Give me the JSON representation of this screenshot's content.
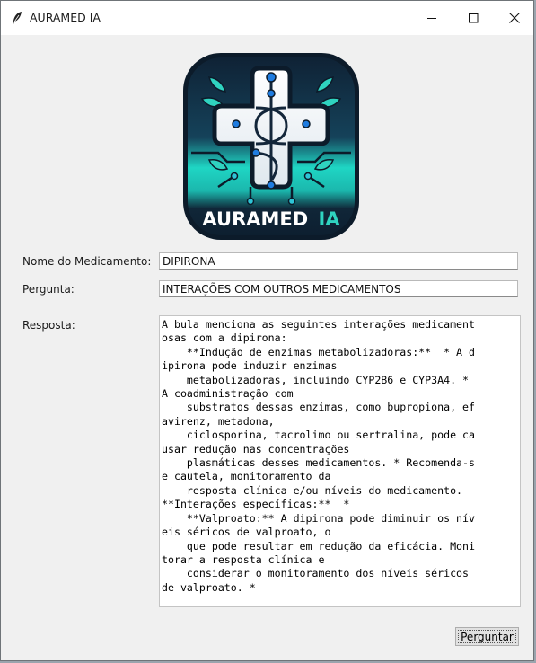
{
  "window": {
    "title": "AURAMED IA",
    "icons": {
      "app": "feather-icon",
      "minimize": "minimize-icon",
      "maximize": "maximize-icon",
      "close": "close-icon"
    }
  },
  "logo": {
    "text_main": "AURAMED",
    "text_accent": "IA",
    "colors": {
      "dark": "#13263a",
      "teal": "#1fd6c4",
      "accent": "#2ec4d6"
    }
  },
  "form": {
    "medicamento_label": "Nome do Medicamento:",
    "medicamento_value": "DIPIRONA",
    "pergunta_label": "Pergunta:",
    "pergunta_value": "INTERAÇÕES COM OUTROS MEDICAMENTOS",
    "resposta_label": "Resposta:",
    "resposta_lines": [
      "A bula menciona as seguintes interações medicament",
      "osas com a dipirona:",
      "    **Indução de enzimas metabolizadoras:**  * A d",
      "ipirona pode induzir enzimas",
      "    metabolizadoras, incluindo CYP2B6 e CYP3A4. *",
      "A coadministração com",
      "    substratos dessas enzimas, como bupropiona, ef",
      "avirenz, metadona,",
      "    ciclosporina, tacrolimo ou sertralina, pode ca",
      "usar redução nas concentrações",
      "    plasmáticas desses medicamentos. * Recomenda-s",
      "e cautela, monitoramento da",
      "    resposta clínica e/ou níveis do medicamento.",
      "**Interações específicas:**  *",
      "    **Valproato:** A dipirona pode diminuir os nív",
      "eis séricos de valproato, o",
      "    que pode resultar em redução da eficácia. Moni",
      "torar a resposta clínica e",
      "    considerar o monitoramento dos níveis séricos",
      "de valproato. *"
    ],
    "submit_label": "Perguntar"
  }
}
